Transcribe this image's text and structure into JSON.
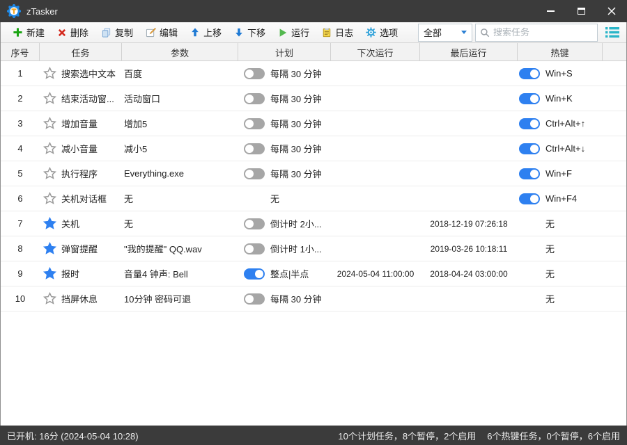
{
  "window": {
    "title": "zTasker"
  },
  "titlebar_controls": {
    "minimize": "minimize",
    "maximize": "maximize",
    "close": "close"
  },
  "toolbar": {
    "buttons": [
      {
        "id": "new",
        "icon": "plus-icon",
        "label": "新建"
      },
      {
        "id": "delete",
        "icon": "delete-x-icon",
        "label": "删除"
      },
      {
        "id": "copy",
        "icon": "copy-icon",
        "label": "复制"
      },
      {
        "id": "edit",
        "icon": "edit-pencil-icon",
        "label": "编辑"
      },
      {
        "id": "move-up",
        "icon": "arrow-up-icon",
        "label": "上移"
      },
      {
        "id": "move-down",
        "icon": "arrow-down-icon",
        "label": "下移"
      },
      {
        "id": "run",
        "icon": "play-icon",
        "label": "运行"
      },
      {
        "id": "log",
        "icon": "clipboard-icon",
        "label": "日志"
      },
      {
        "id": "options",
        "icon": "gear-icon",
        "label": "选项"
      }
    ],
    "filter_value": "全部",
    "search_placeholder": "搜索任务",
    "view_icon": "list-view-icon"
  },
  "table": {
    "headers": [
      "序号",
      "任务",
      "参数",
      "计划",
      "下次运行",
      "最后运行",
      "热键"
    ],
    "rows": [
      {
        "num": "1",
        "starred": false,
        "task": "搜索选中文本",
        "param": "百度",
        "schedule_toggle": "off",
        "schedule": "每隔 30 分钟",
        "next_run": "",
        "last_run": "",
        "hotkey_toggle": "on",
        "hotkey": "Win+S"
      },
      {
        "num": "2",
        "starred": false,
        "task": "结束活动窗...",
        "param": "活动窗口",
        "schedule_toggle": "off",
        "schedule": "每隔 30 分钟",
        "next_run": "",
        "last_run": "",
        "hotkey_toggle": "on",
        "hotkey": "Win+K"
      },
      {
        "num": "3",
        "starred": false,
        "task": "增加音量",
        "param": "增加5",
        "schedule_toggle": "off",
        "schedule": "每隔 30 分钟",
        "next_run": "",
        "last_run": "",
        "hotkey_toggle": "on",
        "hotkey": "Ctrl+Alt+↑"
      },
      {
        "num": "4",
        "starred": false,
        "task": "减小音量",
        "param": "减小5",
        "schedule_toggle": "off",
        "schedule": "每隔 30 分钟",
        "next_run": "",
        "last_run": "",
        "hotkey_toggle": "on",
        "hotkey": "Ctrl+Alt+↓"
      },
      {
        "num": "5",
        "starred": false,
        "task": "执行程序",
        "param": "Everything.exe",
        "schedule_toggle": "off",
        "schedule": "每隔 30 分钟",
        "next_run": "",
        "last_run": "",
        "hotkey_toggle": "on",
        "hotkey": "Win+F"
      },
      {
        "num": "6",
        "starred": false,
        "task": "关机对话框",
        "param": "无",
        "schedule_toggle": "none",
        "schedule": "无",
        "next_run": "",
        "last_run": "",
        "hotkey_toggle": "on",
        "hotkey": "Win+F4"
      },
      {
        "num": "7",
        "starred": true,
        "task": "关机",
        "param": "无",
        "schedule_toggle": "off",
        "schedule": "倒计时 2小...",
        "next_run": "",
        "last_run": "2018-12-19 07:26:18",
        "hotkey_toggle": "none",
        "hotkey": "无"
      },
      {
        "num": "8",
        "starred": true,
        "task": "弹窗提醒",
        "param": "\"我的提醒\" QQ.wav",
        "schedule_toggle": "off",
        "schedule": "倒计时 1小...",
        "next_run": "",
        "last_run": "2019-03-26 10:18:11",
        "hotkey_toggle": "none",
        "hotkey": "无"
      },
      {
        "num": "9",
        "starred": true,
        "task": "报时",
        "param": "音量4 钟声: Bell",
        "schedule_toggle": "on",
        "schedule": "整点|半点",
        "next_run": "2024-05-04 11:00:00",
        "last_run": "2018-04-24 03:00:00",
        "hotkey_toggle": "none",
        "hotkey": "无"
      },
      {
        "num": "10",
        "starred": false,
        "task": "挡屏休息",
        "param": "10分钟 密码可退",
        "schedule_toggle": "off",
        "schedule": "每隔 30 分钟",
        "next_run": "",
        "last_run": "",
        "hotkey_toggle": "none",
        "hotkey": "无"
      }
    ]
  },
  "statusbar": {
    "left": "已开机: 16分 (2024-05-04 10:28)",
    "schedule_summary": "10个计划任务，8个暂停，2个启用",
    "hotkey_summary": "6个热键任务，0个暂停，6个启用"
  },
  "colors": {
    "titlebar_bg": "#3b3b3b",
    "accent_blue": "#2e80f0",
    "toggle_off_gray": "#a6a6a6",
    "toolbar_green": "#1ca514",
    "toolbar_red": "#d42a1e",
    "arrow_blue": "#1f7ad4",
    "view_icon_teal": "#2ab5c8"
  }
}
